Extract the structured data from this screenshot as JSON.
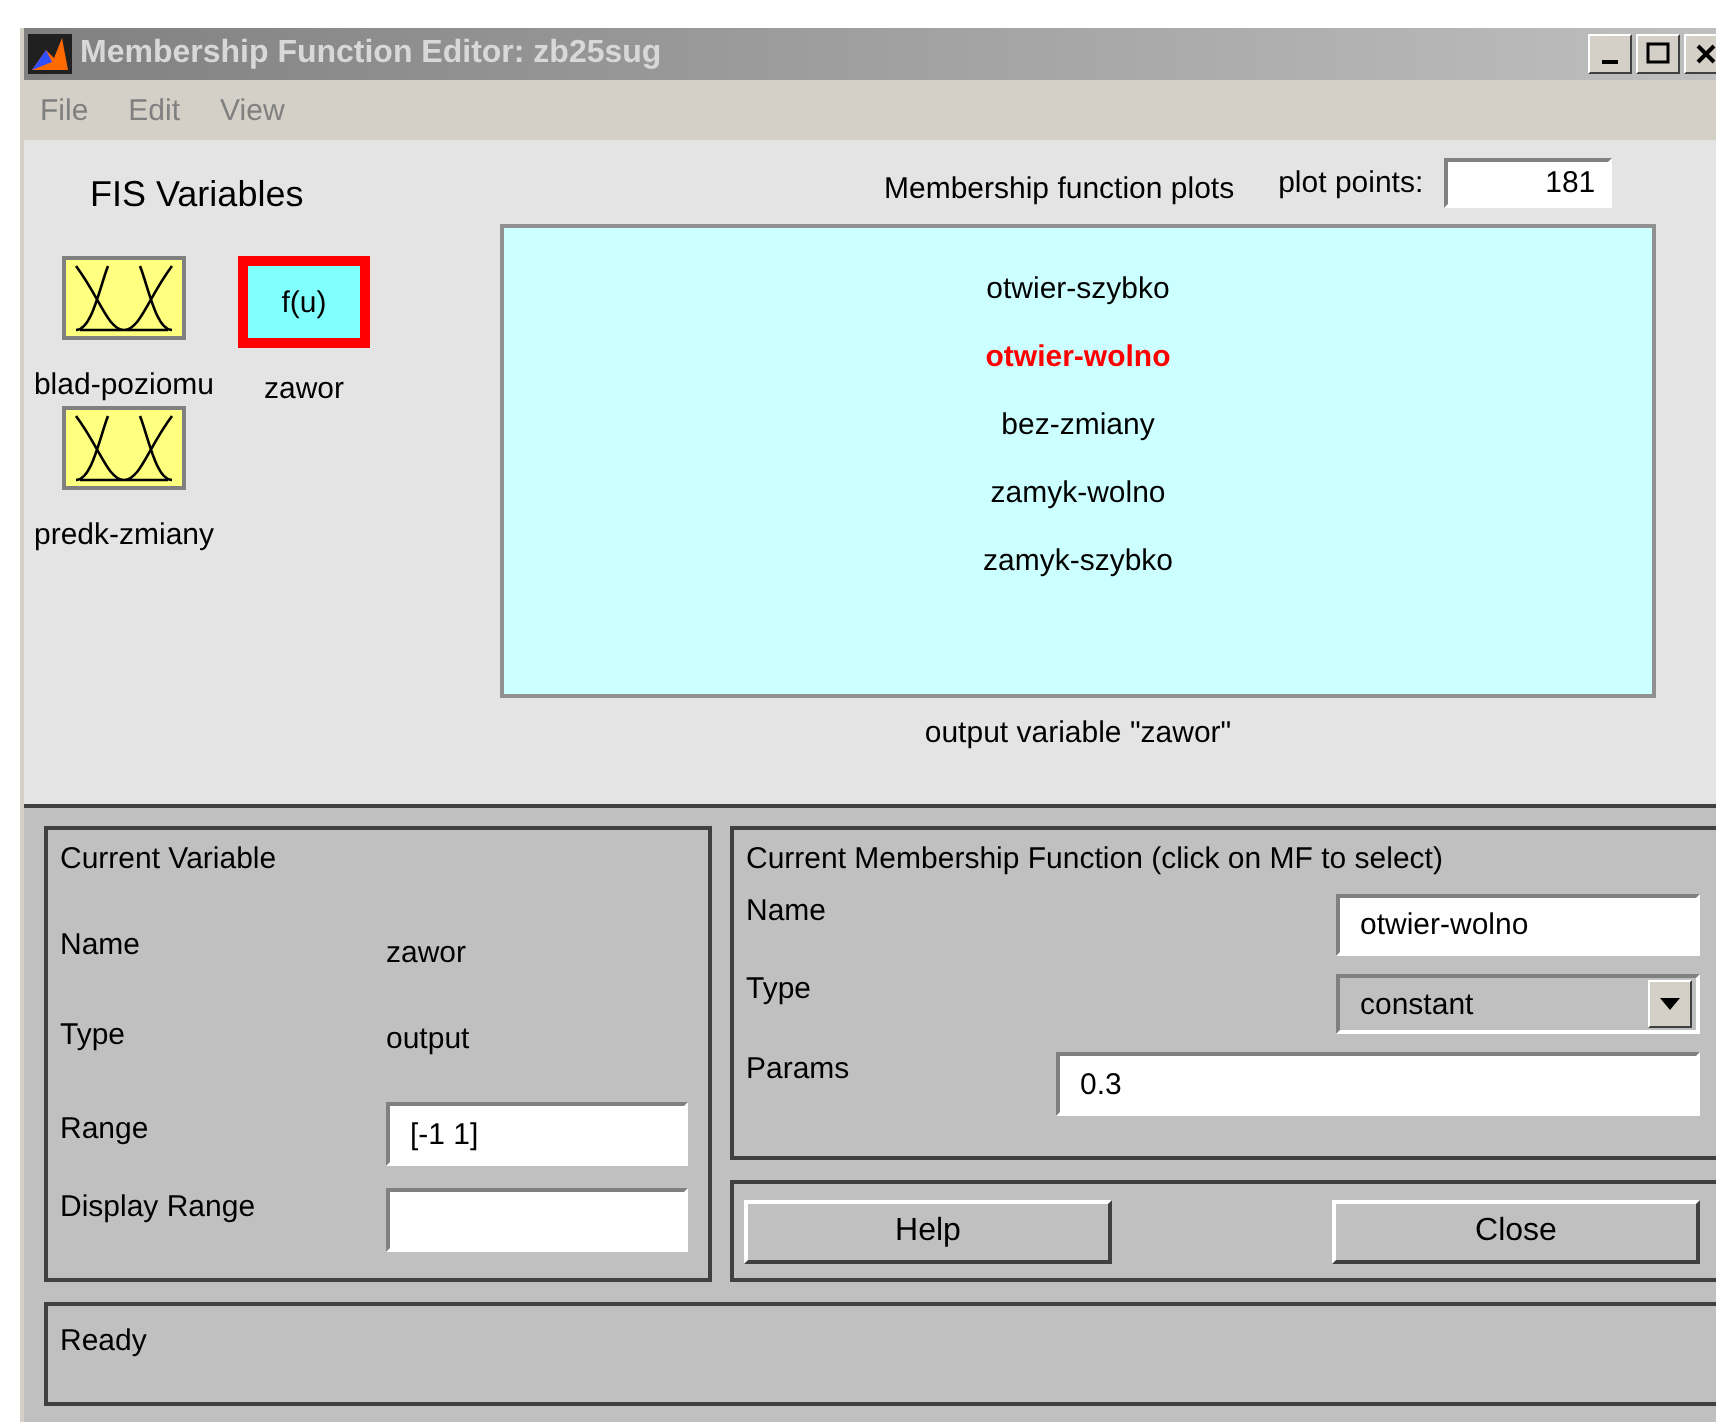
{
  "window": {
    "title": "Membership Function Editor: zb25sug"
  },
  "menu": [
    "File",
    "Edit",
    "View"
  ],
  "fis_variables": {
    "title": "FIS Variables",
    "items": [
      {
        "name": "blad-poziomu",
        "kind": "input",
        "selected": false
      },
      {
        "name": "zawor",
        "kind": "output",
        "label": "f(u)",
        "selected": true
      },
      {
        "name": "predk-zmiany",
        "kind": "input",
        "selected": false
      }
    ]
  },
  "plot": {
    "title": "Membership function plots",
    "plot_points_label": "plot points:",
    "plot_points": "181",
    "caption": "output variable \"zawor\"",
    "functions": [
      {
        "name": "otwier-szybko",
        "selected": false
      },
      {
        "name": "otwier-wolno",
        "selected": true
      },
      {
        "name": "bez-zmiany",
        "selected": false
      },
      {
        "name": "zamyk-wolno",
        "selected": false
      },
      {
        "name": "zamyk-szybko",
        "selected": false
      }
    ]
  },
  "current_variable": {
    "title": "Current Variable",
    "name_label": "Name",
    "name": "zawor",
    "type_label": "Type",
    "type": "output",
    "range_label": "Range",
    "range": "[-1 1]",
    "display_range_label": "Display Range"
  },
  "current_mf": {
    "title": "Current Membership Function (click on MF to select)",
    "name_label": "Name",
    "name": "otwier-wolno",
    "type_label": "Type",
    "type": "constant",
    "params_label": "Params",
    "params": "0.3"
  },
  "buttons": [
    "Help",
    "Close"
  ],
  "status_bar": "Ready"
}
